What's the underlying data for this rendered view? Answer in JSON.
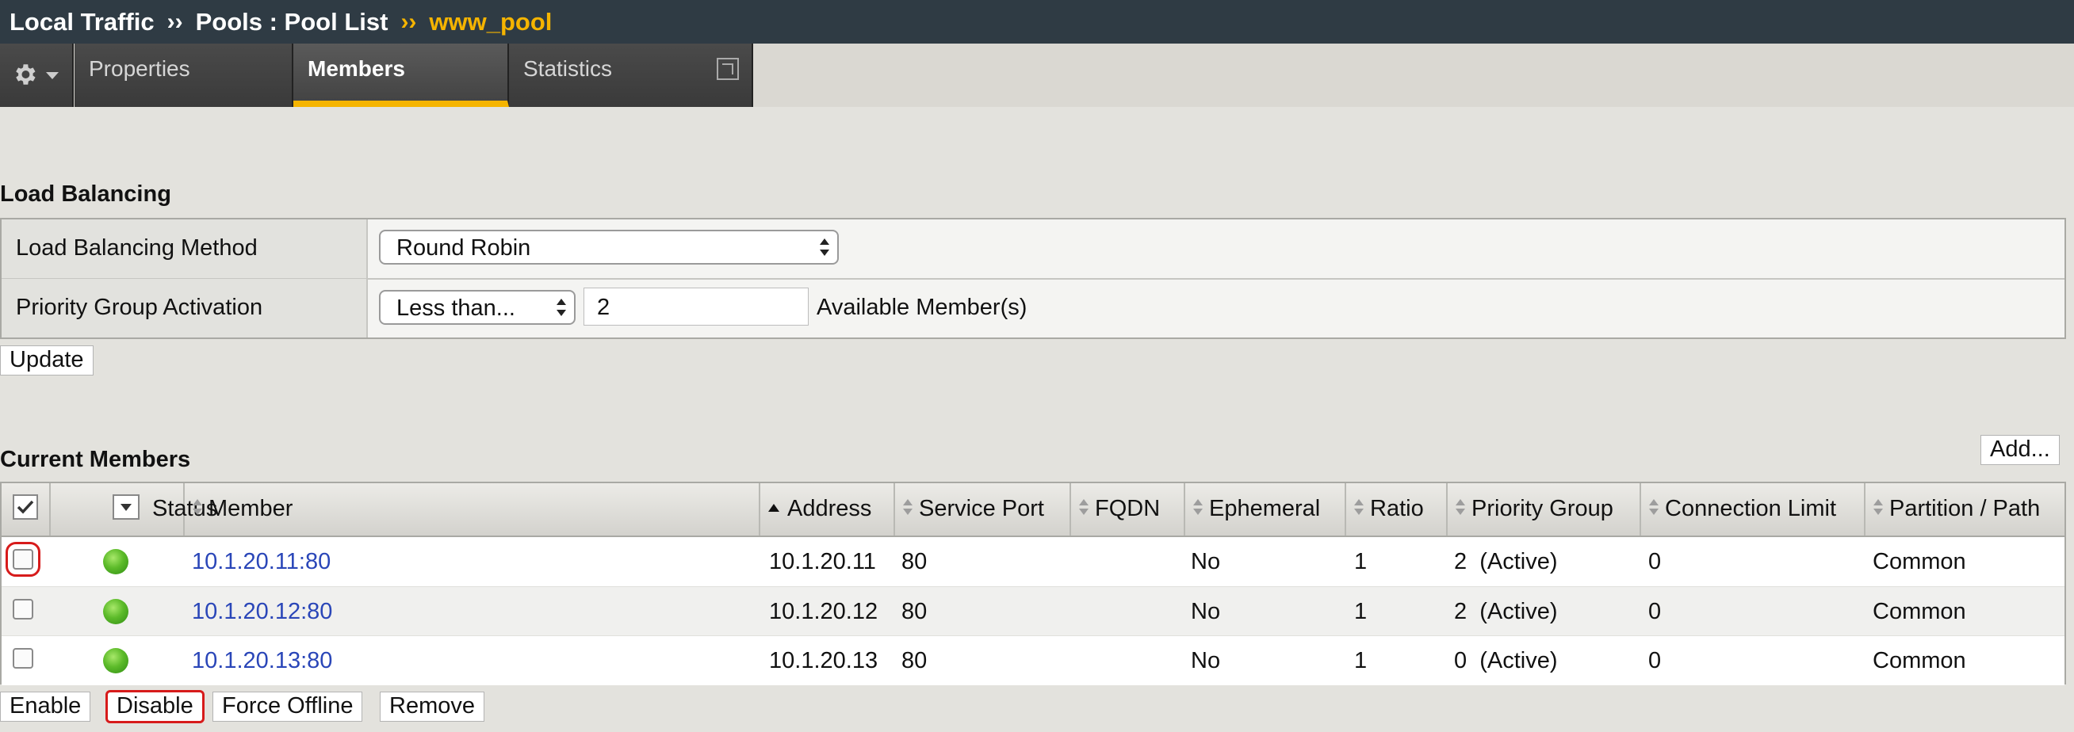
{
  "breadcrumb": {
    "items": [
      "Local Traffic",
      "Pools : Pool List"
    ],
    "separator": "››",
    "current": "www_pool"
  },
  "tabs": [
    {
      "label": "Properties"
    },
    {
      "label": "Members"
    },
    {
      "label": "Statistics"
    }
  ],
  "load_balancing": {
    "title": "Load Balancing",
    "method_label": "Load Balancing Method",
    "method_value": "Round Robin",
    "priority_label": "Priority Group Activation",
    "priority_select": "Less than...",
    "priority_input": "2",
    "priority_suffix": "Available Member(s)",
    "update_button": "Update"
  },
  "current_members": {
    "title": "Current Members",
    "add_button": "Add...",
    "columns": [
      "Status",
      "Member",
      "Address",
      "Service Port",
      "FQDN",
      "Ephemeral",
      "Ratio",
      "Priority Group",
      "Connection Limit",
      "Partition / Path"
    ],
    "rows": [
      {
        "member": "10.1.20.11:80",
        "address": "10.1.20.11",
        "port": "80",
        "fqdn": "",
        "ephemeral": "No",
        "ratio": "1",
        "priority": "2  (Active)",
        "conn_limit": "0",
        "partition": "Common"
      },
      {
        "member": "10.1.20.12:80",
        "address": "10.1.20.12",
        "port": "80",
        "fqdn": "",
        "ephemeral": "No",
        "ratio": "1",
        "priority": "2  (Active)",
        "conn_limit": "0",
        "partition": "Common"
      },
      {
        "member": "10.1.20.13:80",
        "address": "10.1.20.13",
        "port": "80",
        "fqdn": "",
        "ephemeral": "No",
        "ratio": "1",
        "priority": "0  (Active)",
        "conn_limit": "0",
        "partition": "Common"
      }
    ],
    "actions": [
      "Enable",
      "Disable",
      "Force Offline",
      "Remove"
    ]
  },
  "colors": {
    "topbar": "#2f3b44",
    "accent": "#f5b400",
    "link": "#2a46b8",
    "highlight": "#d71b1b",
    "status_green": "#5dbb2a"
  }
}
